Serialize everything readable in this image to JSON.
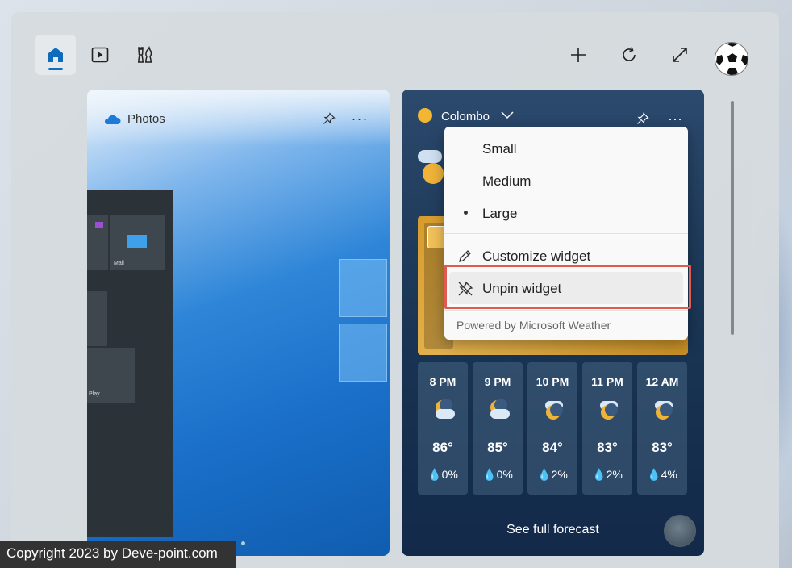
{
  "toolbar": {
    "home_icon": "home-icon",
    "video_icon": "play-icon",
    "chess_icon": "chess-icon",
    "add_icon": "plus-icon",
    "refresh_icon": "refresh-icon",
    "expand_icon": "expand-icon",
    "accent": "#0f6cbd"
  },
  "photos_widget": {
    "title": "Photos",
    "tiles": {
      "mail_label": "Mail",
      "play_label": "Play"
    }
  },
  "weather_widget": {
    "location": "Colombo",
    "hourly": [
      {
        "time": "8 PM",
        "temp": "86°",
        "precip": "0%"
      },
      {
        "time": "9 PM",
        "temp": "85°",
        "precip": "0%"
      },
      {
        "time": "10 PM",
        "temp": "84°",
        "precip": "2%"
      },
      {
        "time": "11 PM",
        "temp": "83°",
        "precip": "2%"
      },
      {
        "time": "12 AM",
        "temp": "83°",
        "precip": "4%"
      }
    ],
    "full_forecast_label": "See full forecast"
  },
  "context_menu": {
    "items": [
      {
        "label": "Small",
        "selected": false
      },
      {
        "label": "Medium",
        "selected": false
      },
      {
        "label": "Large",
        "selected": true
      }
    ],
    "customize_label": "Customize widget",
    "unpin_label": "Unpin widget",
    "footer": "Powered by Microsoft Weather",
    "highlight_color": "#e05a52"
  },
  "watermark": "Copyright 2023 by Deve-point.com"
}
